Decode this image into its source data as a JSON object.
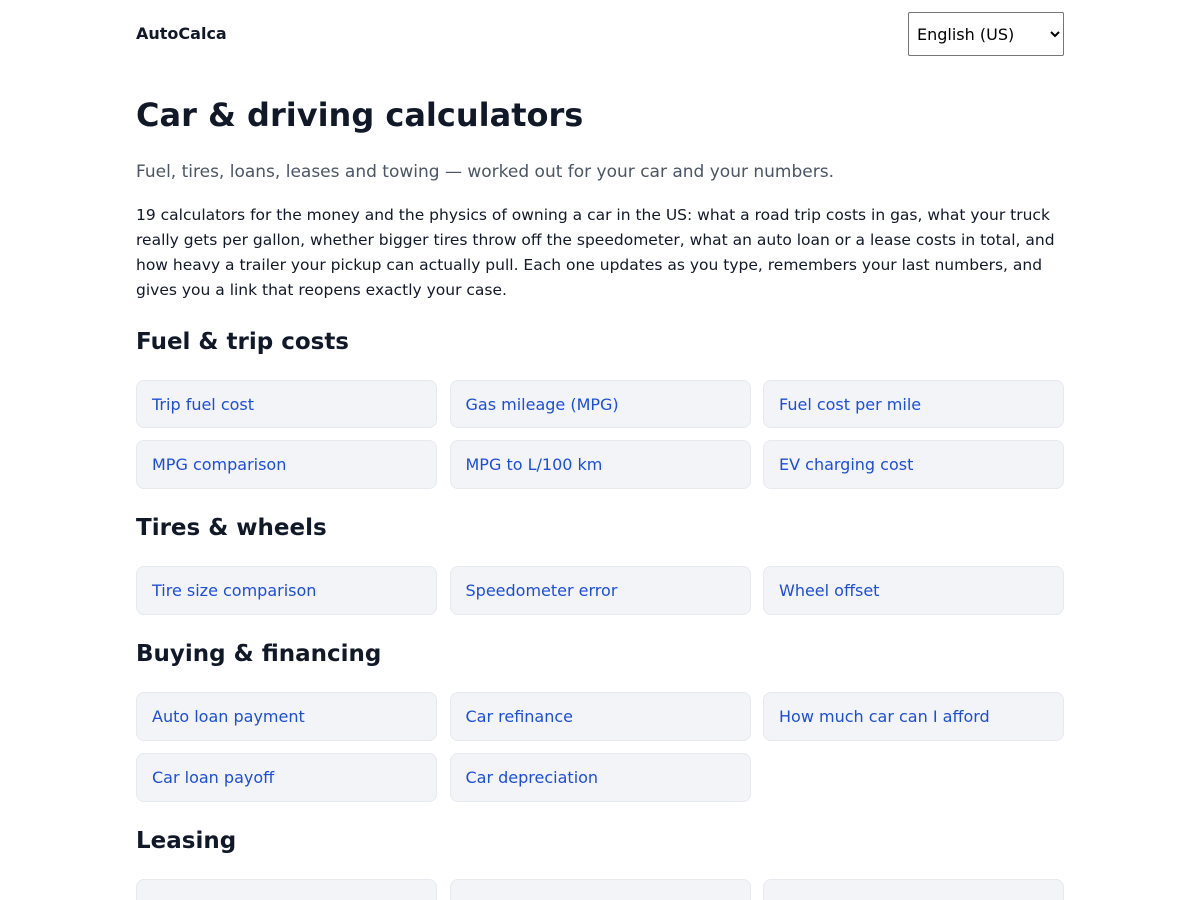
{
  "header": {
    "brand": "AutoCalca",
    "language": "English (US)"
  },
  "page": {
    "title": "Car & driving calculators",
    "tagline": "Fuel, tires, loans, leases and towing — worked out for your car and your numbers.",
    "intro": "19 calculators for the money and the physics of owning a car in the US: what a road trip costs in gas, what your truck really gets per gallon, whether bigger tires throw off the speedometer, what an auto loan or a lease costs in total, and how heavy a trailer your pickup can actually pull. Each one updates as you type, remembers your last numbers, and gives you a link that reopens exactly your case."
  },
  "sections": {
    "fuel": {
      "title": "Fuel & trip costs",
      "items": [
        "Trip fuel cost",
        "Gas mileage (MPG)",
        "Fuel cost per mile",
        "MPG comparison",
        "MPG to L/100 km",
        "EV charging cost"
      ]
    },
    "tires": {
      "title": "Tires & wheels",
      "items": [
        "Tire size comparison",
        "Speedometer error",
        "Wheel offset"
      ]
    },
    "buying": {
      "title": "Buying & financing",
      "items": [
        "Auto loan payment",
        "Car refinance",
        "How much car can I afford",
        "Car loan payoff",
        "Car depreciation"
      ]
    },
    "leasing": {
      "title": "Leasing"
    }
  },
  "colors": {
    "link": "#1d4ed8",
    "card_background": "#f2f4f7",
    "heading": "#111827",
    "muted": "#4b5563"
  }
}
